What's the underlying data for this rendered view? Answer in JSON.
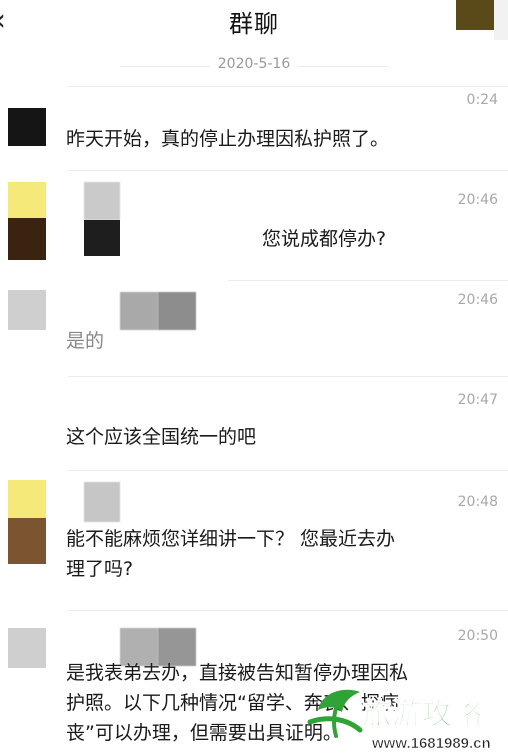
{
  "header": {
    "back_icon": "chevron-left-icon",
    "title": "群聊"
  },
  "date_divider": "2020-5-16",
  "messages": [
    {
      "time": "0:24",
      "text": "昨天开始，真的停止办理因私护照了。"
    },
    {
      "time": "20:46",
      "text": "您说成都停办?"
    },
    {
      "time": "20:46",
      "text": "是的"
    },
    {
      "time": "20:47",
      "text": "这个应该全国统一的吧"
    },
    {
      "time": "20:48",
      "text": "能不能麻烦您详细讲一下？ 您最近去办\n理了吗?"
    },
    {
      "time": "20:50",
      "text": "是我表弟去办，直接被告知暂停办理因私\n护照。以下几种情况“留学、奔丧、探病\n丧”可以办理，但需要出具证明。"
    }
  ],
  "watermark": {
    "logo_text": "旅游攻略",
    "url": "www.1681989.cn"
  },
  "colors": {
    "avatar_yellow": "#f5e97a",
    "avatar_brown": "#7a5530",
    "avatar_dark": "#151515",
    "avatar_gray": "#c8c8c8",
    "watermark_green": "#2fa336"
  }
}
